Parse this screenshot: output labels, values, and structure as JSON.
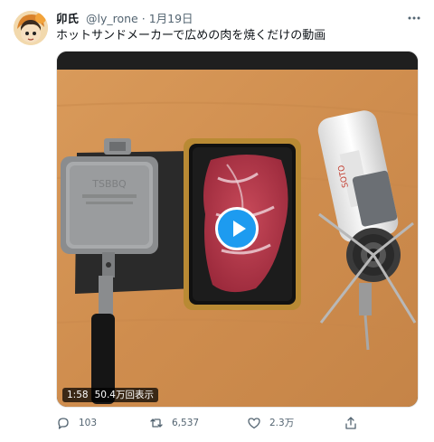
{
  "user": {
    "display_name": "卯氏",
    "handle": "@ly_rone",
    "separator": "·",
    "date": "1月19日"
  },
  "tweet": {
    "text": "ホットサンドメーカーで広めの肉を焼くだけの動画"
  },
  "video": {
    "duration": "1:58",
    "views": "50.4万回表示",
    "can_brand": "SOTO"
  },
  "actions": {
    "reply_count": "103",
    "retweet_count": "6,537",
    "like_count": "2.3万"
  },
  "icons": {
    "more": "more-horizontal-icon",
    "reply": "reply-icon",
    "retweet": "retweet-icon",
    "like": "heart-icon",
    "share": "share-icon"
  },
  "colors": {
    "accent": "#1d9bf0",
    "secondary_text": "#536471",
    "primary_text": "#0f1419"
  }
}
